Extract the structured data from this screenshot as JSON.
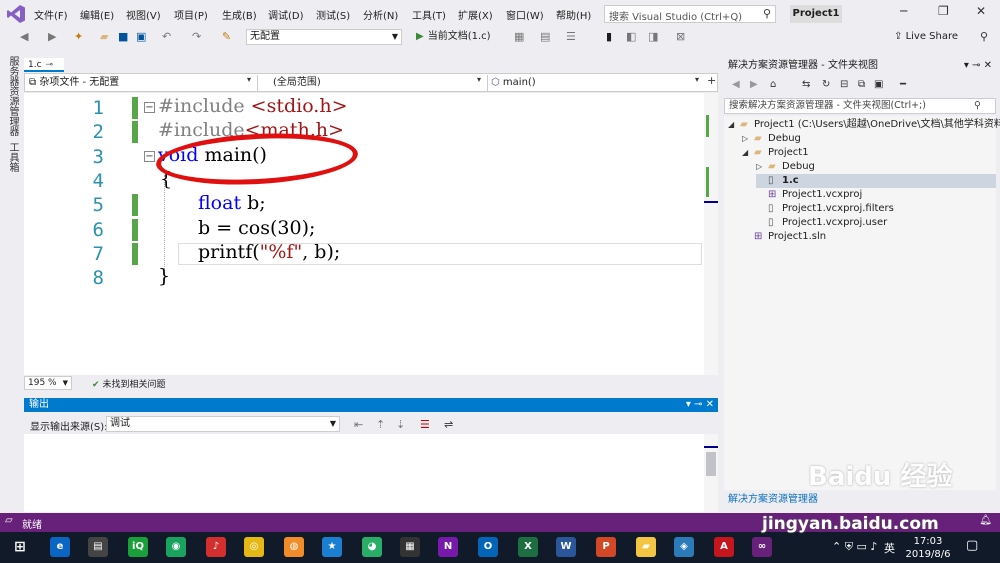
{
  "menu": {
    "items": [
      "文件(F)",
      "编辑(E)",
      "视图(V)",
      "项目(P)",
      "生成(B)",
      "调试(D)",
      "测试(S)",
      "分析(N)",
      "工具(T)",
      "扩展(X)",
      "窗口(W)",
      "帮助(H)"
    ],
    "search_placeholder": "搜索 Visual Studio (Ctrl+Q)",
    "project_name": "Project1"
  },
  "toolbar": {
    "config": "无配置",
    "run_label": "当前文档(1.c)",
    "live_share": "Live Share"
  },
  "left_strip": {
    "tab1": "服务器资源管理器",
    "tab2": "工具箱"
  },
  "editor": {
    "tab_name": "1.c",
    "nav_scope": "杂项文件 - 无配置",
    "nav_global": "(全局范围)",
    "nav_function": "main()",
    "line_numbers": [
      "1",
      "2",
      "3",
      "4",
      "5",
      "6",
      "7",
      "8"
    ],
    "zoom": "195 %",
    "issues": "未找到相关问题"
  },
  "code": {
    "l1_pp": "#include",
    "l1_str": "<stdio.h>",
    "l2_pp": "#include",
    "l2_str": "<math.h>",
    "l3_kw": "void",
    "l3_rest": "main()",
    "l4": "{",
    "l5_kw": "float",
    "l5_rest": "b;",
    "l6": "b = cos(30);",
    "l7_a": "printf(",
    "l7_str": "\"%f\"",
    "l7_b": ", b);",
    "l8": "}"
  },
  "output": {
    "title": "输出",
    "source_label": "显示输出来源(S):",
    "source_value": "调试"
  },
  "solution_explorer": {
    "title": "解决方案资源管理器 - 文件夹视图",
    "search_placeholder": "搜索解决方案资源管理器 - 文件夹视图(Ctrl+;)",
    "tree": [
      {
        "label": "Project1 (C:\\Users\\超越\\OneDrive\\文档\\其他学科资料",
        "icon": "folder-open-icon"
      },
      {
        "label": "Debug",
        "icon": "folder-icon"
      },
      {
        "label": "Project1",
        "icon": "folder-open-icon"
      },
      {
        "label": "Debug",
        "icon": "folder-icon"
      },
      {
        "label": "1.c",
        "icon": "c-file-icon"
      },
      {
        "label": "Project1.vcxproj",
        "icon": "vcxproj-icon"
      },
      {
        "label": "Project1.vcxproj.filters",
        "icon": "file-icon"
      },
      {
        "label": "Project1.vcxproj.user",
        "icon": "file-icon"
      },
      {
        "label": "Project1.sln",
        "icon": "sln-icon"
      }
    ],
    "footer": "解决方案资源管理器"
  },
  "status": {
    "text": "就绪"
  },
  "taskbar": {
    "time": "17:03",
    "date": "2019/8/6",
    "ime": "英"
  },
  "watermark": {
    "text": "Baidu 经验",
    "url": "jingyan.baidu.com"
  },
  "colors": {
    "accent": "#007acc",
    "status_bar": "#68217a",
    "annotation": "#e01010"
  }
}
